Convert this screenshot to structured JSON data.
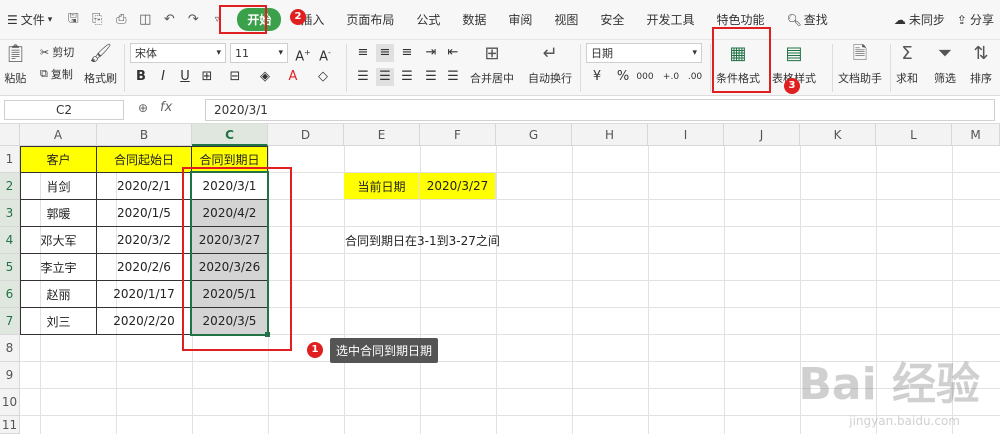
{
  "menubar": {
    "menu_icon": "hamburger-icon",
    "file_label": "文件",
    "tabs": [
      {
        "label": "开始"
      },
      {
        "label": "插入"
      },
      {
        "label": "页面布局"
      },
      {
        "label": "公式"
      },
      {
        "label": "数据"
      },
      {
        "label": "审阅"
      },
      {
        "label": "视图"
      },
      {
        "label": "安全"
      },
      {
        "label": "开发工具"
      },
      {
        "label": "特色功能"
      }
    ],
    "search_label": "查找",
    "sync_label": "未同步",
    "share_label": "分享"
  },
  "ribbon": {
    "paste": "粘贴",
    "cut": "剪切",
    "copy": "复制",
    "format_painter": "格式刷",
    "font_name": "宋体",
    "font_size": "11",
    "bold": "B",
    "italic": "I",
    "underline": "U",
    "merge_center": "合并居中",
    "wrap_text": "自动换行",
    "number_format": "日期",
    "percent": "%",
    "thousands": "000",
    "inc_dec": "+.0",
    "dec_dec": ".00",
    "conditional_format": "条件格式",
    "table_style": "表格样式",
    "doc_helper": "文档助手",
    "sum": "求和",
    "filter": "筛选",
    "sort": "排序"
  },
  "formula_bar": {
    "name_box": "C2",
    "fx": "fx",
    "value": "2020/3/1"
  },
  "grid": {
    "columns": [
      "A",
      "B",
      "C",
      "D",
      "E",
      "F",
      "G",
      "H",
      "I",
      "J",
      "K",
      "L",
      "M"
    ],
    "rows": [
      "1",
      "2",
      "3",
      "4",
      "5",
      "6",
      "7",
      "8",
      "9",
      "10",
      "11"
    ],
    "headers": [
      "客户",
      "合同起始日",
      "合同到期日"
    ],
    "records": [
      {
        "customer": "肖剑",
        "start": "2020/2/1",
        "end": "2020/3/1"
      },
      {
        "customer": "郭暖",
        "start": "2020/1/5",
        "end": "2020/4/2"
      },
      {
        "customer": "邓大军",
        "start": "2020/3/2",
        "end": "2020/3/27"
      },
      {
        "customer": "李立宇",
        "start": "2020/2/6",
        "end": "2020/3/26"
      },
      {
        "customer": "赵丽",
        "start": "2020/1/17",
        "end": "2020/5/1"
      },
      {
        "customer": "刘三",
        "start": "2020/2/20",
        "end": "2020/3/5"
      }
    ],
    "current_date_label": "当前日期",
    "current_date_value": "2020/3/27",
    "note": "合同到期日在3-1到3-27之间"
  },
  "annotations": {
    "step1": "1",
    "step2": "2",
    "step3": "3",
    "tooltip": "选中合同到期日期"
  },
  "watermark": {
    "brand": "Bai 经验",
    "url": "jingyan.baidu.com"
  },
  "colors": {
    "accent_green": "#3aa04a",
    "header_yellow": "#ffff00",
    "annotation_red": "#e02020",
    "selection_green": "#217346"
  }
}
